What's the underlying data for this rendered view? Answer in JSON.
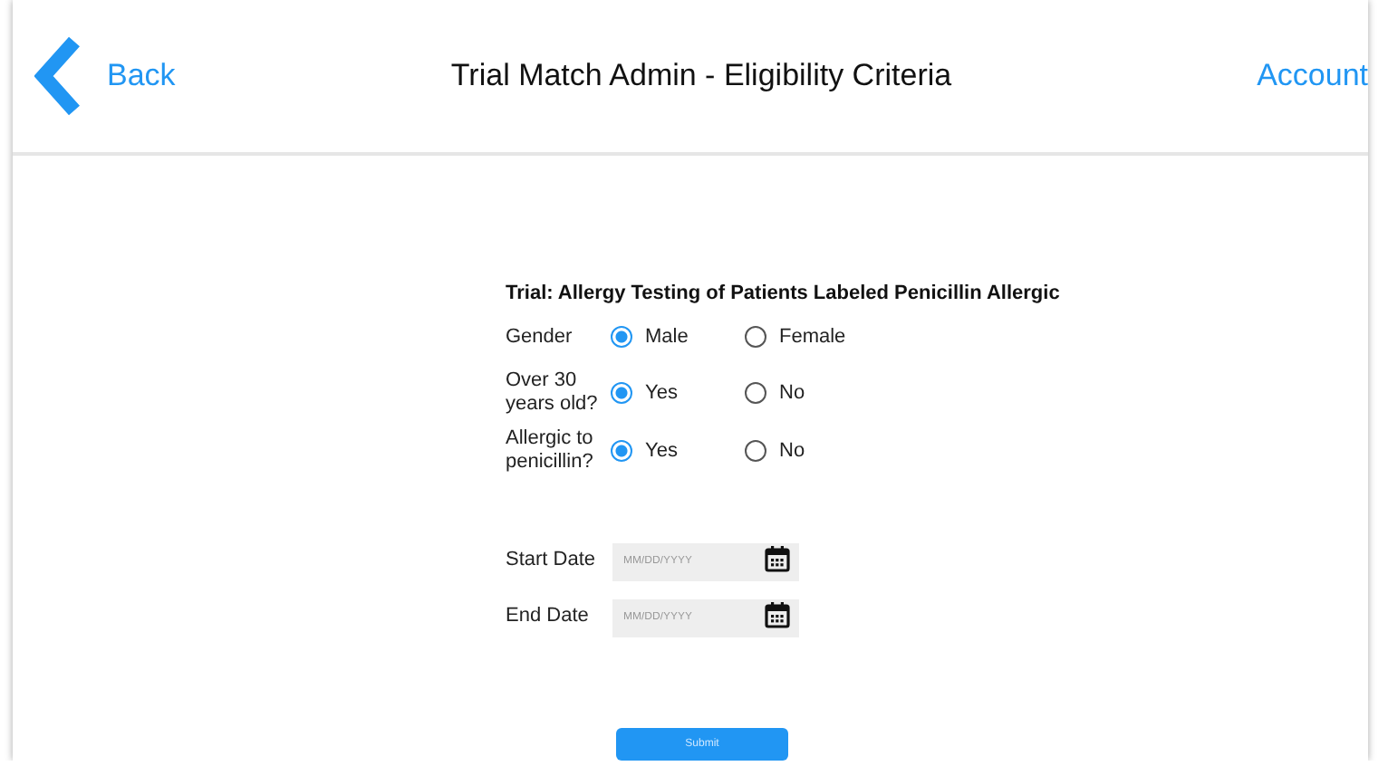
{
  "header": {
    "back": "Back",
    "title": "Trial Match Admin - Eligibility Criteria",
    "account": "Account"
  },
  "form": {
    "title": "Trial: Allergy Testing of Patients Labeled Penicillin Allergic",
    "questions": [
      {
        "label": "Gender",
        "options": [
          {
            "label": "Male",
            "selected": true
          },
          {
            "label": "Female",
            "selected": false
          }
        ]
      },
      {
        "label": "Over 30 years old?",
        "options": [
          {
            "label": "Yes",
            "selected": true
          },
          {
            "label": "No",
            "selected": false
          }
        ]
      },
      {
        "label": "Allergic to penicillin?",
        "options": [
          {
            "label": "Yes",
            "selected": true
          },
          {
            "label": "No",
            "selected": false
          }
        ]
      }
    ],
    "dates": [
      {
        "label": "Start Date",
        "placeholder": "MM/DD/YYYY"
      },
      {
        "label": "End Date",
        "placeholder": "MM/DD/YYYY"
      }
    ],
    "submit": "Submit"
  }
}
